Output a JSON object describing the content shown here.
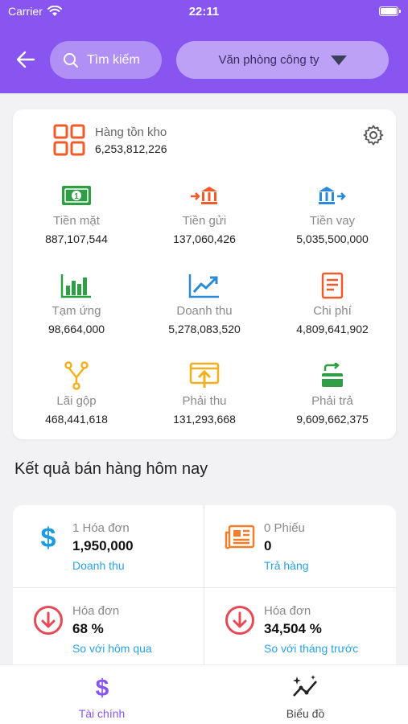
{
  "status": {
    "carrier": "Carrier",
    "time": "22:11"
  },
  "header": {
    "search_placeholder": "Tìm kiếm",
    "office_label": "Văn phòng công ty"
  },
  "inventory": {
    "label": "Hàng tồn kho",
    "value": "6,253,812,226"
  },
  "metrics": [
    {
      "label": "Tiền mặt",
      "value": "887,107,544",
      "icon": "cash-icon"
    },
    {
      "label": "Tiền gửi",
      "value": "137,060,426",
      "icon": "bank-deposit-icon"
    },
    {
      "label": "Tiền vay",
      "value": "5,035,500,000",
      "icon": "bank-loan-icon"
    },
    {
      "label": "Tạm ứng",
      "value": "98,664,000",
      "icon": "bar-chart-icon"
    },
    {
      "label": "Doanh thu",
      "value": "5,278,083,520",
      "icon": "trend-up-icon"
    },
    {
      "label": "Chi phí",
      "value": "4,809,641,902",
      "icon": "document-icon"
    },
    {
      "label": "Lãi gộp",
      "value": "468,441,618",
      "icon": "merge-icon"
    },
    {
      "label": "Phải thu",
      "value": "131,293,668",
      "icon": "receivable-icon"
    },
    {
      "label": "Phải trả",
      "value": "9,609,662,375",
      "icon": "payable-icon"
    }
  ],
  "sales": {
    "title": "Kết quả bán hàng hôm nay",
    "cards": [
      {
        "line1": "1 Hóa đơn",
        "line2": "1,950,000",
        "line3": "Doanh thu",
        "icon": "dollar-icon"
      },
      {
        "line1": "0 Phiếu",
        "line2": "0",
        "line3": "Trả hàng",
        "icon": "return-icon"
      },
      {
        "line1": "Hóa đơn",
        "line2": "68 %",
        "line3": "So với hôm qua",
        "icon": "arrow-down-circle-icon"
      },
      {
        "line1": "Hóa đơn",
        "line2": "34,504 %",
        "line3": "So với tháng trước",
        "icon": "arrow-down-circle-icon"
      }
    ]
  },
  "tabs": [
    {
      "label": "Tài chính",
      "active": true
    },
    {
      "label": "Biểu đồ",
      "active": false
    }
  ],
  "colors": {
    "header": "#8855f0",
    "accent": "#2aa1e6",
    "active_tab": "#8855f0"
  }
}
